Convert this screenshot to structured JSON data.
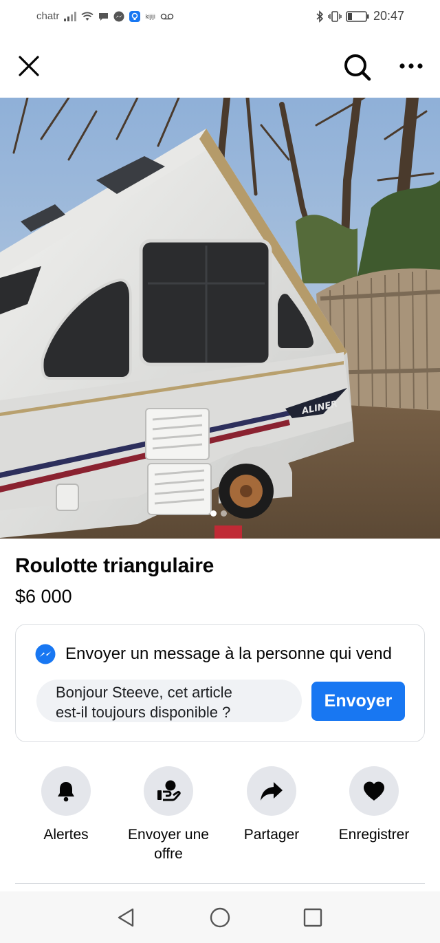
{
  "status_bar": {
    "carrier": "chatr",
    "kijiji_label": "kijiji",
    "time": "20:47",
    "icons": [
      "signal-icon",
      "wifi-icon",
      "chat-bubble-icon",
      "messenger-icon",
      "kijiji-icon",
      "voicemail-icon",
      "bluetooth-icon",
      "vibrate-icon",
      "battery-icon"
    ]
  },
  "top_bar": {
    "icons": [
      "close-icon",
      "search-icon",
      "more-icon"
    ]
  },
  "photo": {
    "page_count": 2,
    "active_page": 1,
    "trailer_brand_text": "ALINER"
  },
  "listing": {
    "title": "Roulotte triangulaire",
    "price": "$6 000"
  },
  "message_card": {
    "heading": "Envoyer un message à la personne qui vend",
    "message_line1": "Bonjour Steeve, cet article",
    "message_line2": "est-il toujours disponible ?",
    "send_label": "Envoyer"
  },
  "actions": [
    {
      "label_line1": "Alertes",
      "label_line2": "",
      "icon": "bell-icon"
    },
    {
      "label_line1": "Envoyer une",
      "label_line2": "offre",
      "icon": "offer-icon"
    },
    {
      "label_line1": "Partager",
      "label_line2": "",
      "icon": "share-icon"
    },
    {
      "label_line1": "Enregistrer",
      "label_line2": "",
      "icon": "heart-icon"
    }
  ],
  "nav_bar": {
    "icons": [
      "back-icon",
      "home-icon",
      "recents-icon"
    ]
  },
  "colors": {
    "accent": "#1877f2",
    "action_circle": "#e4e6eb",
    "input_bg": "#f0f2f5"
  }
}
